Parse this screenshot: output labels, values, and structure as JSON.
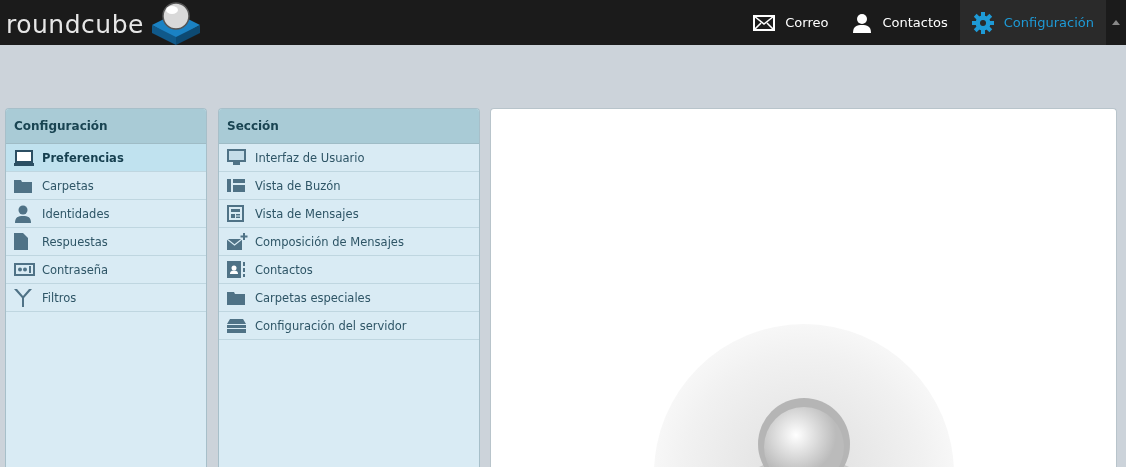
{
  "header": {
    "logo": "roundcube",
    "nav": [
      {
        "label": "Correo",
        "selected": false
      },
      {
        "label": "Contactos",
        "selected": false
      },
      {
        "label": "Configuración",
        "selected": true
      }
    ]
  },
  "settings_panel": {
    "title": "Configuración",
    "items": [
      {
        "label": "Preferencias",
        "selected": true
      },
      {
        "label": "Carpetas",
        "selected": false
      },
      {
        "label": "Identidades",
        "selected": false
      },
      {
        "label": "Respuestas",
        "selected": false
      },
      {
        "label": "Contraseña",
        "selected": false
      },
      {
        "label": "Filtros",
        "selected": false
      }
    ]
  },
  "section_panel": {
    "title": "Sección",
    "items": [
      {
        "label": "Interfaz de Usuario",
        "selected": false
      },
      {
        "label": "Vista de Buzón",
        "selected": false
      },
      {
        "label": "Vista de Mensajes",
        "selected": false
      },
      {
        "label": "Composición de Mensajes",
        "selected": false
      },
      {
        "label": "Contactos",
        "selected": false
      },
      {
        "label": "Carpetas especiales",
        "selected": false
      },
      {
        "label": "Configuración del servidor",
        "selected": false
      }
    ]
  }
}
